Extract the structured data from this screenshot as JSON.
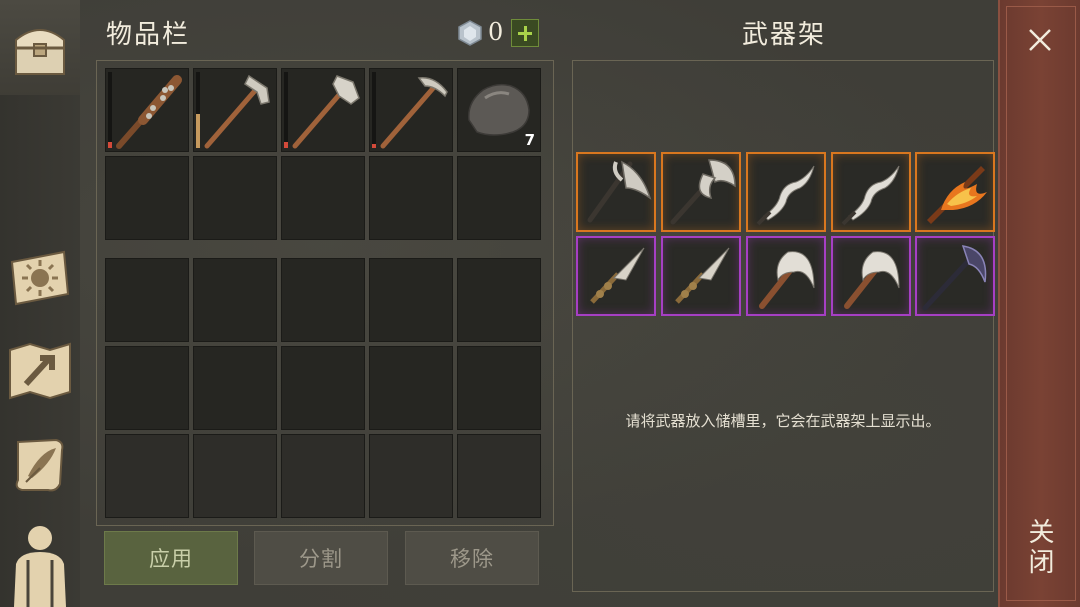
{
  "inventory": {
    "title": "物品栏",
    "currency_value": "0",
    "slots": [
      {
        "item": "spiked-club",
        "durability": 0.08
      },
      {
        "item": "hammer",
        "durability": 0.45
      },
      {
        "item": "stone-axe-hammer",
        "durability": 0.08
      },
      {
        "item": "pickaxe",
        "durability": 0.05
      },
      {
        "item": "stone",
        "quantity": "7"
      }
    ],
    "buttons": {
      "apply": "应用",
      "split": "分割",
      "remove": "移除"
    }
  },
  "rack": {
    "title": "武器架",
    "hint": "请将武器放入储槽里，它会在武器架上显示出。",
    "weapons_row1": [
      "halberd-axe",
      "battle-axe",
      "wavy-blade",
      "wavy-blade",
      "flame-sword"
    ],
    "weapons_row2": [
      "spear-dagger",
      "spear-dagger",
      "scythe",
      "scythe",
      "dark-scythe"
    ],
    "rarity_colors": {
      "orange": "#d9771f",
      "purple": "#a63fc4"
    }
  },
  "close": {
    "label": "关闭"
  },
  "sidenav": [
    "chest-icon",
    "map-sun-icon",
    "crafting-map-icon",
    "scroll-quill-icon",
    "character-icon"
  ]
}
